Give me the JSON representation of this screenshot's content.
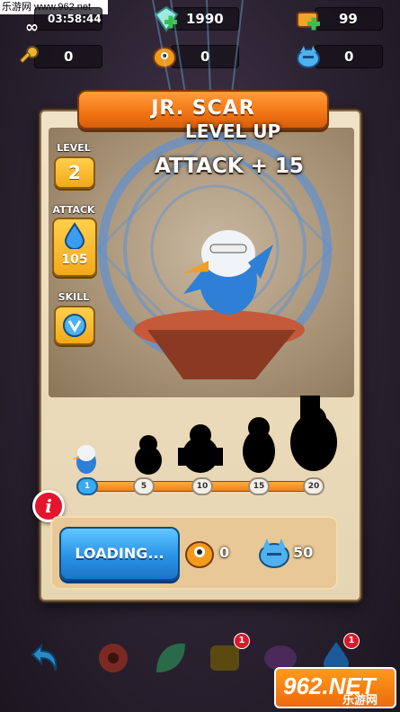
{
  "watermark_top": "乐游网 www.962.net",
  "resources": {
    "timer": "03:58:44",
    "infinity": "∞",
    "gems": "1990",
    "chests": "99",
    "keys": "0",
    "orange_monster": "0",
    "blue_monster": "0"
  },
  "dialog": {
    "hero_name": "JR. SCAR",
    "level_up": "LEVEL UP",
    "attack_bonus": "ATTACK + 15",
    "level_label": "LEVEL",
    "level_value": "2",
    "attack_label": "ATTACK",
    "attack_value": "105",
    "skill_label": "SKILL"
  },
  "evolution": {
    "milestones": [
      "1",
      "5",
      "10",
      "15",
      "20"
    ],
    "progress_fraction": 0.0
  },
  "upgrade": {
    "button_label": "LOADING...",
    "orange_cost": "0",
    "blue_cost": "50"
  },
  "bottom_bar": {
    "badge_1": "1",
    "badge_2": "1"
  },
  "watermark_logo": {
    "big": "962.NET",
    "small": "乐游网"
  },
  "colors": {
    "banner_orange": "#f47716",
    "button_blue": "#2a93e6",
    "stat_gold": "#f2a91b",
    "info_red": "#e4162e"
  }
}
